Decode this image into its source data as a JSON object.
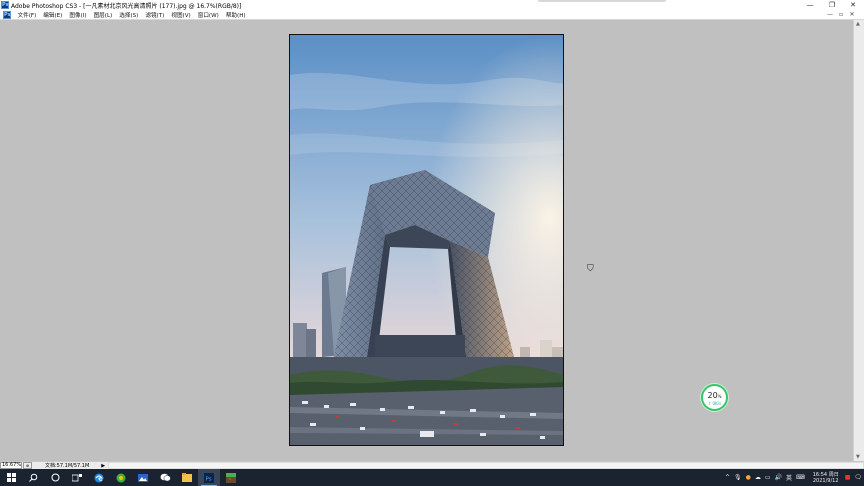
{
  "window": {
    "app_icon": "Ps",
    "title": "Adobe Photoshop CS3 - [一凡素材北京风光高清照片 (177).jpg @ 16.7%(RGB/8)]",
    "minimize": "—",
    "restore": "❐",
    "close": "✕"
  },
  "menubar": {
    "items": [
      "文件(F)",
      "编辑(E)",
      "图像(I)",
      "图层(L)",
      "选择(S)",
      "滤镜(T)",
      "视图(V)",
      "窗口(W)",
      "帮助(H)"
    ],
    "doc_controls": [
      "—",
      "▫",
      "✕"
    ]
  },
  "canvas": {
    "image_subject": "CCTV headquarters tower, Beijing",
    "sky_top": "#5b8fc6",
    "sky_bottom": "#e8d7d8",
    "sun_glow": "#fff0dc"
  },
  "badge": {
    "percent": "20",
    "percent_unit": "%",
    "speed": "↑ 0K/s",
    "ring_color": "#39c46a"
  },
  "statusbar": {
    "zoom": "16.67%",
    "doc_info": "文档:57.1M/57.1M",
    "arrow": "▶"
  },
  "taskbar": {
    "apps": [
      "start-icon",
      "search-icon",
      "taskview-icon",
      "task-icon",
      "edge-icon",
      "browser-icon",
      "photos-icon",
      "wechat-icon",
      "explorer-icon",
      "photoshop-icon",
      "minecraft-icon"
    ],
    "tray": {
      "chevron": "^",
      "ime": "英",
      "time": "16:54 周日",
      "date": "2021/9/12"
    }
  }
}
